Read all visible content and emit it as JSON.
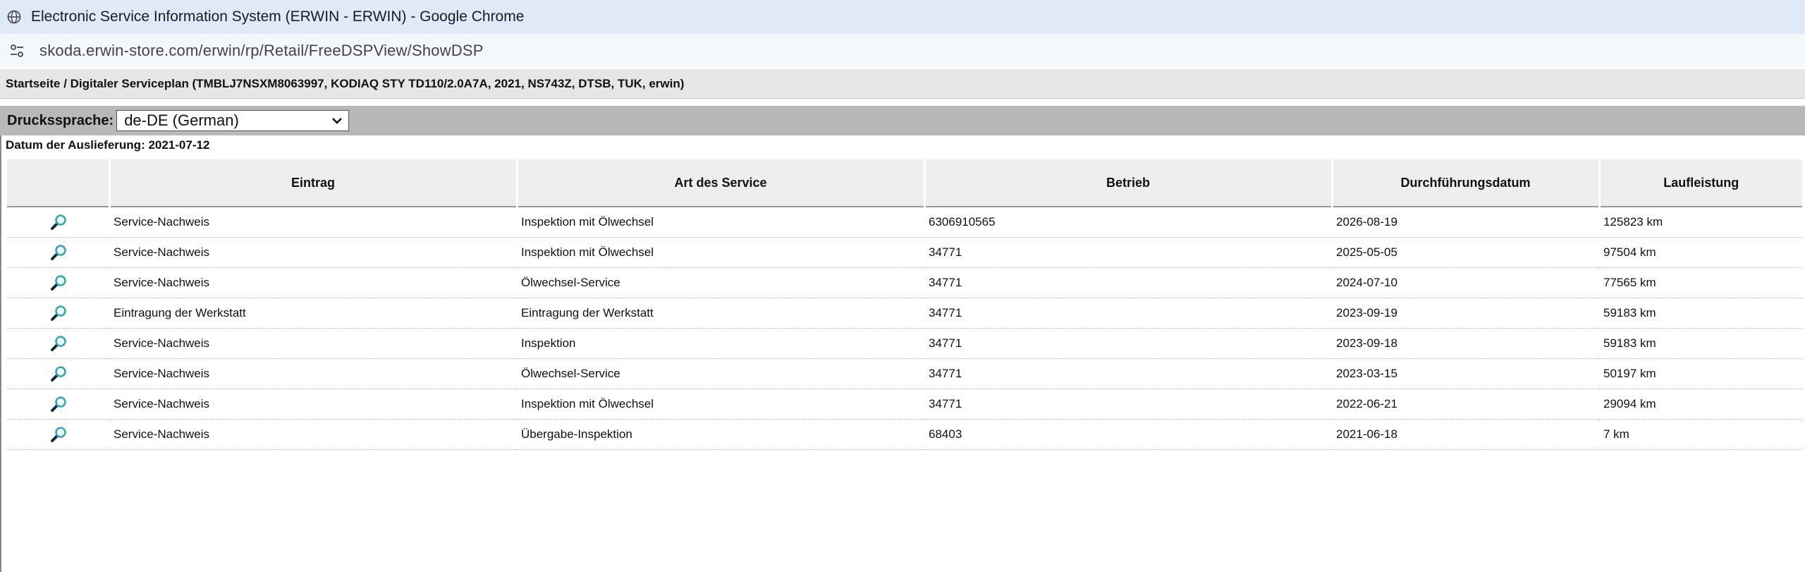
{
  "window": {
    "title": "Electronic Service Information System (ERWIN - ERWIN) - Google Chrome",
    "url": "skoda.erwin-store.com/erwin/rp/Retail/FreeDSPView/ShowDSP"
  },
  "breadcrumb": "Startseite / Digitaler Serviceplan (TMBLJ7NSXM8063997, KODIAQ STY TD110/2.0A7A, 2021, NS743Z, DTSB, TUK, erwin)",
  "print_language": {
    "label": "Druckssprache:",
    "selected": "de-DE (German)"
  },
  "delivery_date": "Datum der Auslieferung: 2021-07-12",
  "table": {
    "headers": [
      "",
      "Eintrag",
      "Art des Service",
      "Betrieb",
      "Durchführungsdatum",
      "Laufleistung"
    ],
    "rows": [
      {
        "entry": "Service-Nachweis",
        "service": "Inspektion mit Ölwechsel",
        "workshop": "6306910565",
        "date": "2026-08-19",
        "mileage": "125823 km"
      },
      {
        "entry": "Service-Nachweis",
        "service": "Inspektion mit Ölwechsel",
        "workshop": "34771",
        "date": "2025-05-05",
        "mileage": "97504 km"
      },
      {
        "entry": "Service-Nachweis",
        "service": "Ölwechsel-Service",
        "workshop": "34771",
        "date": "2024-07-10",
        "mileage": "77565 km"
      },
      {
        "entry": "Eintragung der Werkstatt",
        "service": "Eintragung der Werkstatt",
        "workshop": "34771",
        "date": "2023-09-19",
        "mileage": "59183 km"
      },
      {
        "entry": "Service-Nachweis",
        "service": "Inspektion",
        "workshop": "34771",
        "date": "2023-09-18",
        "mileage": "59183 km"
      },
      {
        "entry": "Service-Nachweis",
        "service": "Ölwechsel-Service",
        "workshop": "34771",
        "date": "2023-03-15",
        "mileage": "50197 km"
      },
      {
        "entry": "Service-Nachweis",
        "service": "Inspektion mit Ölwechsel",
        "workshop": "34771",
        "date": "2022-06-21",
        "mileage": "29094 km"
      },
      {
        "entry": "Service-Nachweis",
        "service": "Übergabe-Inspektion",
        "workshop": "68403",
        "date": "2021-06-18",
        "mileage": "7 km"
      }
    ]
  },
  "icons": {
    "row_view": "magnifier-icon",
    "title": "globe-icon",
    "address": "site-settings-icon",
    "select": "chevron-down-icon"
  },
  "colors": {
    "magnifier_lens": "#3aa6b0",
    "magnifier_handle": "#0c2a3a"
  }
}
